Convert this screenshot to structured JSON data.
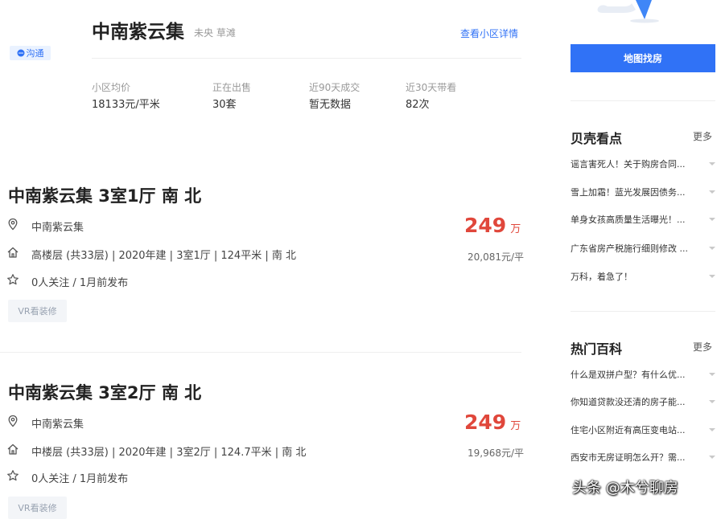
{
  "community": {
    "name": "中南紫云集",
    "area": "未央 草滩",
    "detail_link": "查看小区详情",
    "chat_label": "沟通",
    "stats": [
      {
        "label": "小区均价",
        "value": "18133元/平米"
      },
      {
        "label": "正在出售",
        "value": "30套"
      },
      {
        "label": "近90天成交",
        "value": "暂无数据"
      },
      {
        "label": "近30天带看",
        "value": "82次"
      }
    ]
  },
  "listings": [
    {
      "title": "中南紫云集 3室1厅 南 北",
      "community": "中南紫云集",
      "info": "高楼层 (共33层) | 2020年建 | 3室1厅 | 124平米 | 南 北",
      "follow": "0人关注 / 1月前发布",
      "price": "249",
      "price_unit": "万",
      "unit_price": "20,081元/平",
      "tag": "VR看装修"
    },
    {
      "title": "中南紫云集 3室2厅 南 北",
      "community": "中南紫云集",
      "info": "中楼层 (共33层) | 2020年建 | 3室2厅 | 124.7平米 | 南 北",
      "follow": "0人关注 / 1月前发布",
      "price": "249",
      "price_unit": "万",
      "unit_price": "19,968元/平",
      "tag": "VR看装修"
    }
  ],
  "sidebar": {
    "map_button": "地图找房",
    "beike_section": {
      "title": "贝壳看点",
      "more": "更多",
      "items": [
        "谣言害死人！关于购房合同...",
        "雪上加霜！蓝光发展因债务...",
        "单身女孩高质量生活曝光！...",
        "广东省房产税施行细则修改 ...",
        "万科，着急了！"
      ]
    },
    "wiki_section": {
      "title": "热门百科",
      "more": "更多",
      "items": [
        "什么是双拼户型？有什么优...",
        "你知道贷款没还清的房子能...",
        "住宅小区附近有高压变电站...",
        "西安市无房证明怎么开？需..."
      ]
    }
  },
  "watermark": "头条 @木兮聊房",
  "colors": {
    "accent": "#3072f6",
    "price": "#e0473b",
    "muted": "#999999"
  }
}
